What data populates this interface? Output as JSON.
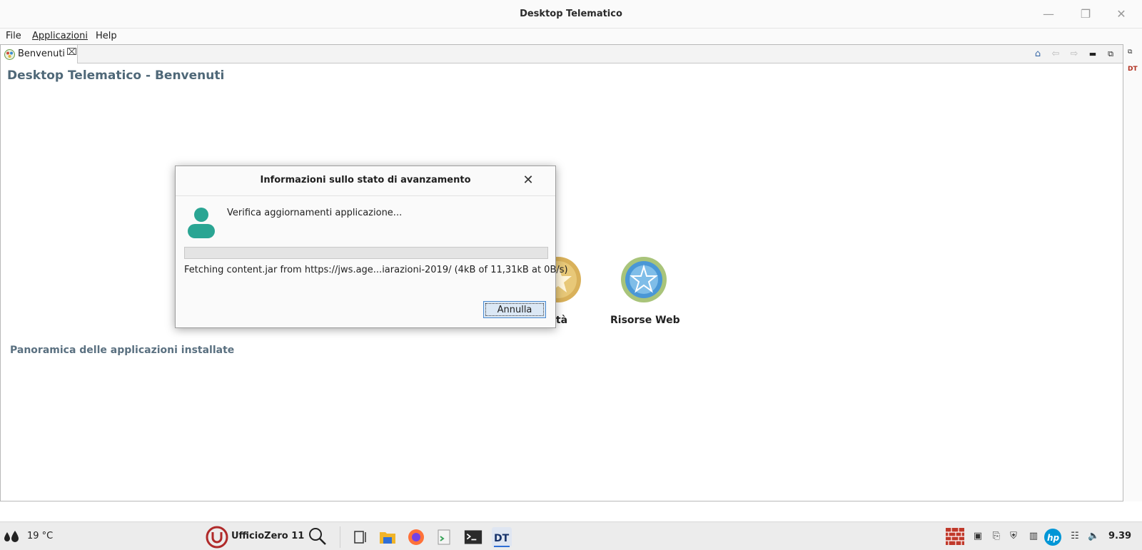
{
  "window": {
    "title": "Desktop Telematico",
    "controls": {
      "minimize_icon": "minimize-icon",
      "maximize_icon": "restore-icon",
      "close_icon": "close-icon"
    }
  },
  "menu": {
    "file": "File",
    "applicazioni": "Applicazioni",
    "help": "Help"
  },
  "editor": {
    "tab": {
      "label": "Benvenuti",
      "icon": "benvenuti-icon",
      "close_icon": "tab-close-icon"
    },
    "toolbar": {
      "home_icon": "home-icon",
      "back_icon": "back-arrow-icon",
      "forward_icon": "forward-arrow-icon",
      "minimize_icon": "view-minimize-icon",
      "maximize_icon": "view-maximize-icon"
    },
    "page_title": "Desktop Telematico - Benvenuti",
    "apps": [
      {
        "label": "vità",
        "icon": "attivita-icon",
        "color": "#d9b15a"
      },
      {
        "label": "Risorse Web",
        "icon": "risorse-web-icon",
        "color": "#4a97d6"
      }
    ],
    "section_title": "Panoramica delle applicazioni installate"
  },
  "sidebar": {
    "restore_icon": "restore-view-icon",
    "dt_label": "DT"
  },
  "dialog": {
    "title": "Informazioni sullo stato di avanzamento",
    "message": "Verifica aggiornamenti applicazione...",
    "progress": 0,
    "detail": "Fetching content.jar from https://jws.age...iarazioni-2019/ (4kB of 11,31kB at 0B/s)",
    "cancel_label": "Annulla"
  },
  "taskbar": {
    "weather": "19 °C",
    "start_label": "UfficioZero 11",
    "clock": "9.39",
    "accent": "#c0392b"
  }
}
